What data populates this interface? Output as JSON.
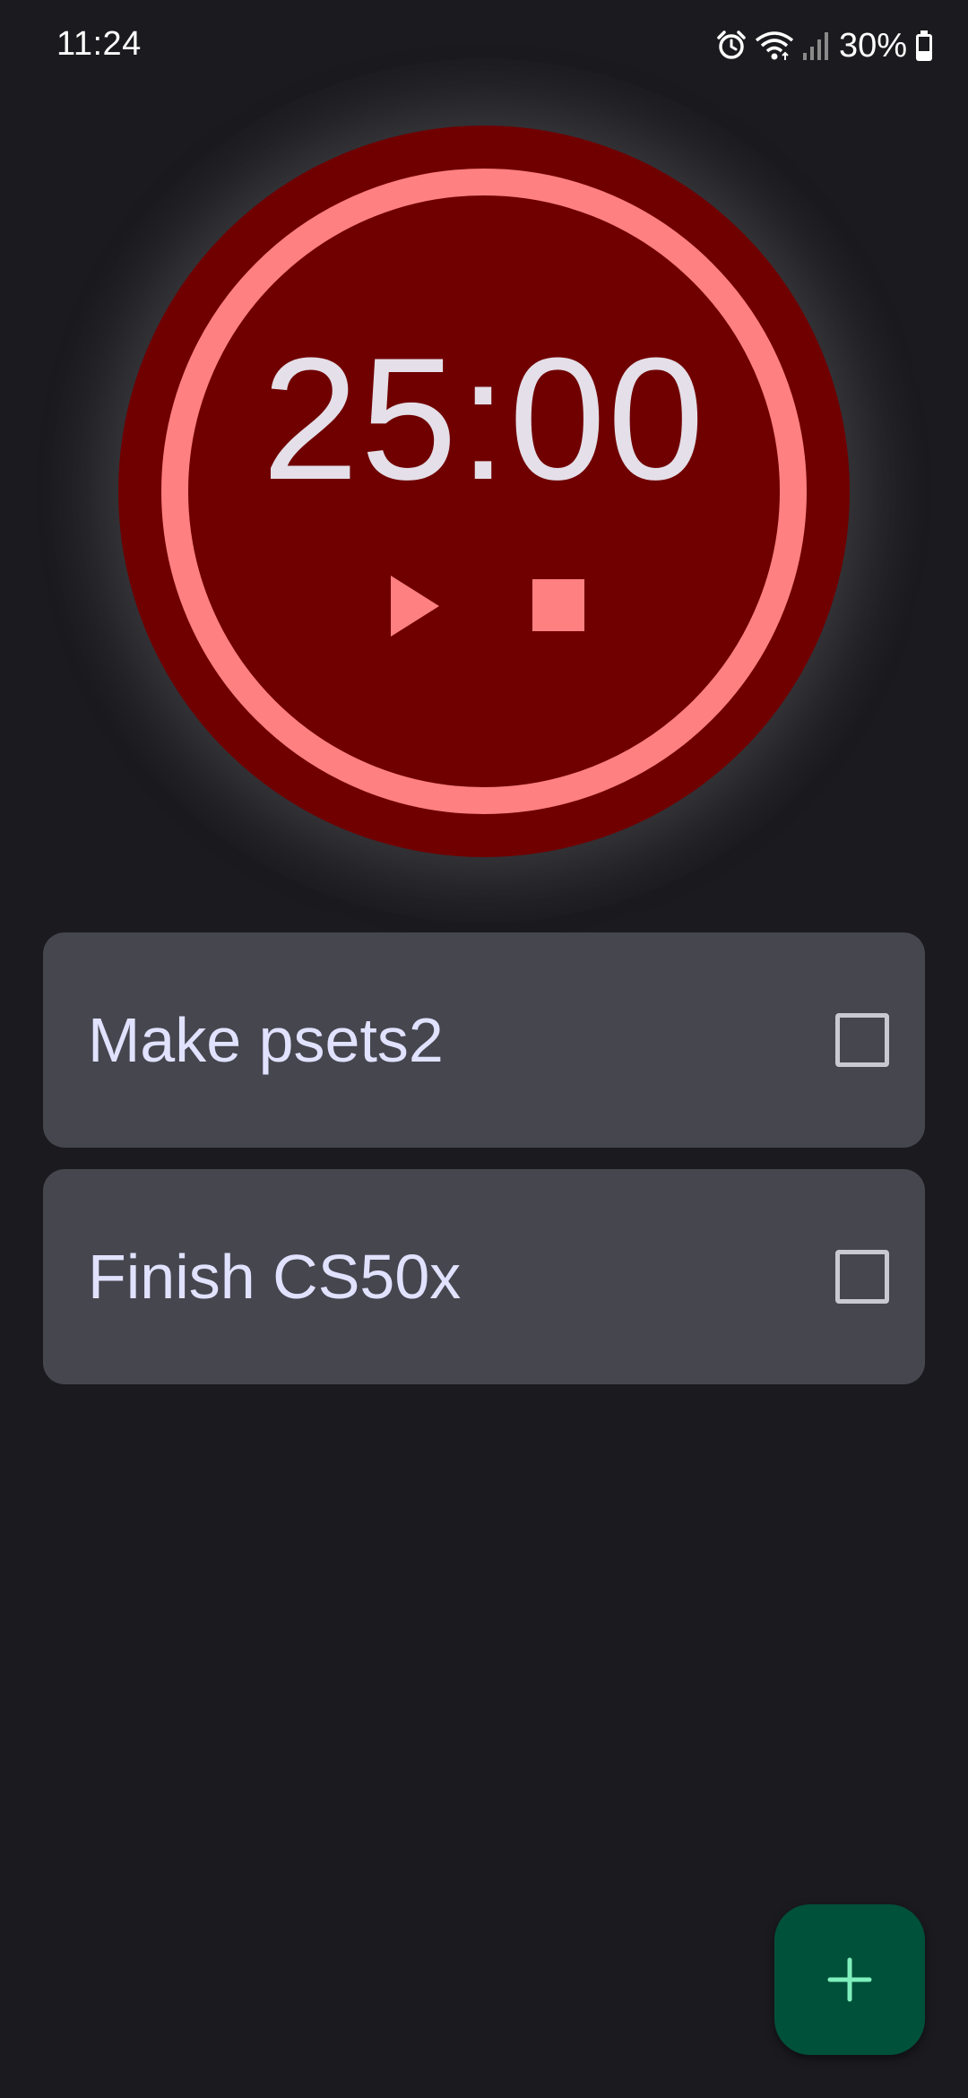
{
  "status_bar": {
    "time": "11:24",
    "battery_percent": "30%",
    "icons": [
      "alarm-icon",
      "wifi-icon",
      "signal-icon",
      "battery-icon"
    ]
  },
  "timer": {
    "display": "25:00",
    "controls": [
      "play-icon",
      "stop-icon"
    ],
    "colors": {
      "background": "#700000",
      "ring": "#ff8080",
      "text": "#e4dfe8"
    }
  },
  "tasks": [
    {
      "label": "Make psets2",
      "checked": false
    },
    {
      "label": "Finish CS50x",
      "checked": false
    }
  ],
  "fab": {
    "icon": "plus-icon",
    "color": "#00513a"
  }
}
